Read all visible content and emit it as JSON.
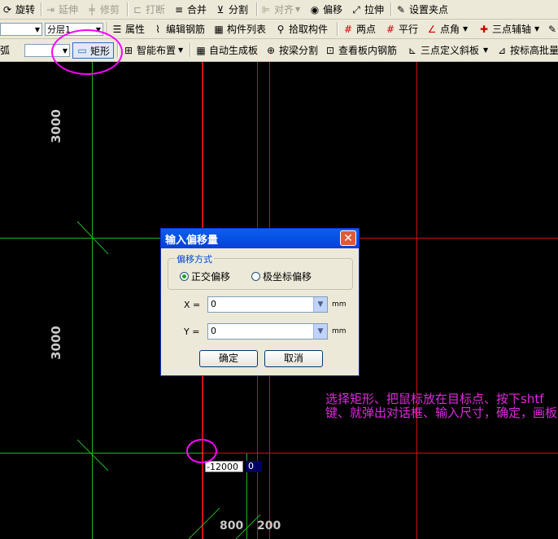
{
  "toolbar1": {
    "rotate": "旋转",
    "extend": "延伸",
    "trim": "修剪",
    "break": "打断",
    "merge": "合并",
    "split": "分割",
    "align": "对齐",
    "offset": "偏移",
    "stretch": "拉伸",
    "set_grip": "设置夹点"
  },
  "toolbar2": {
    "floor_combo": "分层1",
    "properties": "属性",
    "edit_rebar": "编辑钢筋",
    "component_list": "构件列表",
    "pick_component": "拾取构件",
    "two_points": "两点",
    "parallel": "平行",
    "point_angle": "点角",
    "three_point_aux": "三点辅轴"
  },
  "toolbar3": {
    "arc": "弧",
    "rectangle": "矩形",
    "smart_layout": "智能布置",
    "auto_gen_slab": "自动生成板",
    "split_by_beam": "按梁分割",
    "view_slab_rebar": "查看板内钢筋",
    "three_point_slope": "三点定义斜板",
    "batch_by_elev": "按标高批量"
  },
  "canvas": {
    "dim_top": "3000",
    "dim_middle": "3000",
    "dim_bottom_1": "800",
    "dim_bottom_2": "200",
    "coord_x": "-12000",
    "coord_y": "0"
  },
  "dialog": {
    "title": "输入偏移量",
    "group_label": "偏移方式",
    "radio_ortho": "正交偏移",
    "radio_polar": "极坐标偏移",
    "x_label": "X =",
    "y_label": "Y =",
    "x_value": "0",
    "y_value": "0",
    "unit_x": "mm",
    "unit_y": "mm",
    "ok": "确定",
    "cancel": "取消"
  },
  "annotation": "选择矩形、把鼠标放在目标点、按下shtf键、就弹出对话框、输入尺寸，确定，画板"
}
